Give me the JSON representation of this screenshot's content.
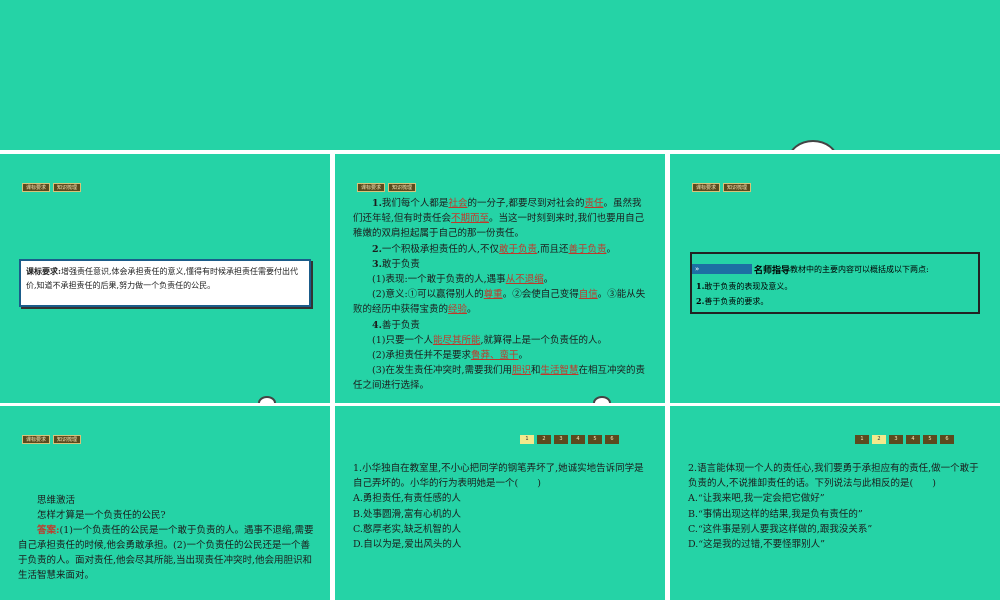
{
  "tabs": {
    "req": "课标要求",
    "knowledge": "知识梳理"
  },
  "slide1": {
    "req_label": "课标要求:",
    "req_text": "增强责任意识,体会承担责任的意义,懂得有时候承担责任需要付出代价,知道不承担责任的后果,努力做一个负责任的公民。"
  },
  "slide2": {
    "p1_a": "1.",
    "p1_b": "我们每个人都是",
    "p1_u1": "社会",
    "p1_c": "的一分子,都要尽到对社会的",
    "p1_u2": "责任",
    "p1_d": "。虽然我们还年轻,但有时责任会",
    "p1_u3": "不期而至",
    "p1_e": "。当这一时刻到来时,我们也要用自己稚嫩的双肩担起属于自己的那一份责任。",
    "p2_a": "2.",
    "p2_b": "一个积极承担责任的人,不仅",
    "p2_u1": "敢于负责",
    "p2_c": ",而且还",
    "p2_u2": "善于负责",
    "p2_d": "。",
    "p3": "3.",
    "p3_title": "敢于负责",
    "p3_1a": "(1)表现:一个敢于负责的人,遇事",
    "p3_1u": "从不退缩",
    "p3_1b": "。",
    "p3_2a": "(2)意义:①可以赢得别人的",
    "p3_2u1": "尊重",
    "p3_2b": "。②会使自己变得",
    "p3_2u2": "自信",
    "p3_2c": "。③能从失败的经历中获得宝贵的",
    "p3_2u3": "经验",
    "p3_2d": "。",
    "p4": "4.",
    "p4_title": "善于负责",
    "p4_1a": "(1)只要一个人",
    "p4_1u": "能尽其所能",
    "p4_1b": ",就算得上是一个负责任的人。",
    "p4_2a": "(2)承担责任并不是要求",
    "p4_2u": "鲁莽、蛮干",
    "p4_2b": "。",
    "p4_3a": "(3)在发生责任冲突时,需要我们用",
    "p4_3u1": "胆识",
    "p4_3b": "和",
    "p4_3u2": "生活智慧",
    "p4_3c": "在相互冲突的责任之间进行选择。"
  },
  "slide3": {
    "bar_icon": "»",
    "title": "名师指导",
    "text": "教材中的主要内容可以概括成以下两点:",
    "item1_n": "1.",
    "item1": "敢于负责的表现及意义。",
    "item2_n": "2.",
    "item2": "善于负责的要求。"
  },
  "slide4": {
    "heading": "思维激活",
    "question": "怎样才算是一个负责任的公民?",
    "answer_label": "答案:",
    "answer": "(1)一个负责任的公民是一个敢于负责的人。遇事不退缩,需要自己承担责任的时候,他会勇敢承担。(2)一个负责任的公民还是一个善于负责的人。面对责任,他会尽其所能,当出现责任冲突时,他会用胆识和生活智慧来面对。"
  },
  "pager": [
    "1",
    "2",
    "3",
    "4",
    "5",
    "6"
  ],
  "slide5": {
    "q": "1.小华独自在教室里,不小心把同学的钢笔弄坏了,她诚实地告诉同学是自己弄坏的。小华的行为表明她是一个(　　)",
    "a": "A.勇担责任,有责任感的人",
    "b": "B.处事圆滑,富有心机的人",
    "c": "C.憨厚老实,缺乏机智的人",
    "d": "D.自以为是,爱出风头的人"
  },
  "slide6": {
    "q": "2.语言能体现一个人的责任心,我们要勇于承担应有的责任,做一个敢于负责的人,不说推卸责任的话。下列说法与此相反的是(　　)",
    "a": "A.“让我来吧,我一定会把它做好”",
    "b": "B.“事情出现这样的结果,我是负有责任的”",
    "c": "C.“这件事是别人要我这样做的,跟我没关系”",
    "d": "D.“这是我的过错,不要怪罪别人”"
  }
}
